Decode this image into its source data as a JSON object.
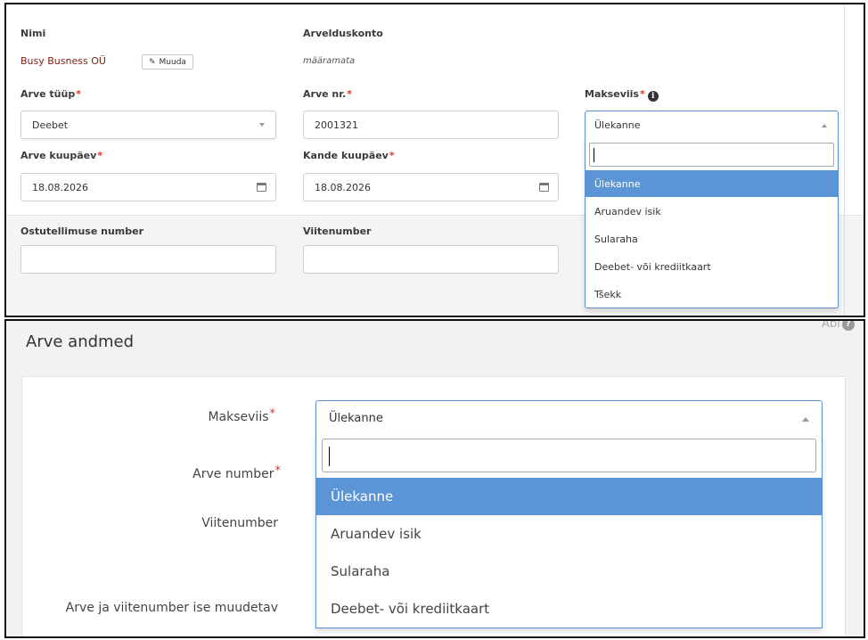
{
  "panel1": {
    "name_label": "Nimi",
    "company_name": "Busy Busness OÜ",
    "edit_button": "Muuda",
    "account_label": "Arvelduskonto",
    "account_value": "määramata",
    "invoice_type_label": "Arve tüüp",
    "invoice_type_value": "Deebet",
    "invoice_nr_label": "Arve nr.",
    "invoice_nr_value": "2001321",
    "payment_method_label": "Makseviis",
    "payment_method_value": "Ülekanne",
    "invoice_date_label": "Arve kuupäev",
    "invoice_date_value": "18.08.2026",
    "entry_date_label": "Kande kuupäev",
    "entry_date_value": "18.08.2026",
    "po_number_label": "Ostutellimuse number",
    "po_number_value": "",
    "reference_label": "Viitenumber",
    "reference_value": "",
    "required_mark": "*",
    "dropdown_options": [
      "Ülekanne",
      "Aruandev isik",
      "Sularaha",
      "Deebet- või krediitkaart",
      "Tšekk"
    ],
    "dropdown_selected": "Ülekanne"
  },
  "panel2": {
    "title": "Arve andmed",
    "help_label": "Abi",
    "payment_method_label": "Makseviis",
    "payment_method_value": "Ülekanne",
    "invoice_number_label": "Arve number",
    "reference_label": "Viitenumber",
    "editable_label": "Arve ja viitenumber ise muudetav",
    "required_mark": "*",
    "dropdown_options": [
      "Ülekanne",
      "Aruandev isik",
      "Sularaha",
      "Deebet- või krediitkaart"
    ],
    "dropdown_selected": "Ülekanne"
  },
  "icons": {
    "edit": "pencil-icon",
    "info": "info-icon",
    "calendar": "calendar-icon",
    "help": "question-icon"
  },
  "colors": {
    "accent": "#5c95d6",
    "required": "#e0322b",
    "company_link": "#7a1f12"
  }
}
